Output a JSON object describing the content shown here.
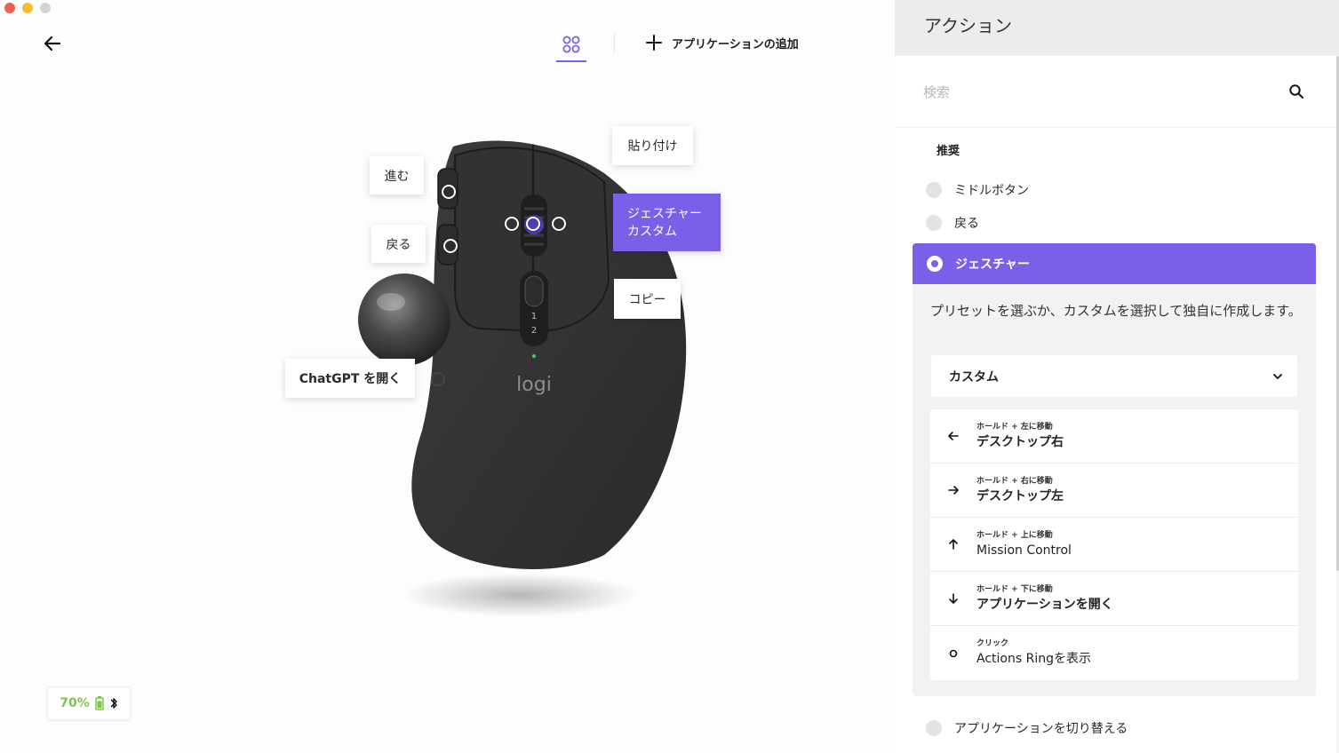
{
  "header": {
    "add_application_label": "アプリケーションの追加"
  },
  "mouse": {
    "brand_logo": "logi",
    "dpi_labels": [
      "1",
      "2"
    ],
    "callouts": {
      "paste": "貼り付け",
      "forward": "進む",
      "back": "戻る",
      "gesture_line1": "ジェスチャー",
      "gesture_line2": "カスタム",
      "copy": "コピー",
      "open_chatgpt": "ChatGPT を開く"
    }
  },
  "status": {
    "battery_percent": "70%",
    "battery_level": 0.7,
    "connection_icon": "bluetooth-icon"
  },
  "panel": {
    "title": "アクション",
    "search_placeholder": "検索",
    "section_recommended": "推奨",
    "options": {
      "middle_button": "ミドルボタン",
      "back": "戻る",
      "gesture": "ジェスチャー",
      "switch_app": "アプリケーションを切り替える"
    },
    "gesture_description": "プリセットを選ぶか、カスタムを選択して独自に作成します。",
    "preset_selected": "カスタム",
    "gestures": [
      {
        "icon": "arrow-left-icon",
        "hint": "ホールド + 左に移動",
        "action": "デスクトップ右",
        "bold": true
      },
      {
        "icon": "arrow-right-icon",
        "hint": "ホールド + 右に移動",
        "action": "デスクトップ左",
        "bold": true
      },
      {
        "icon": "arrow-up-icon",
        "hint": "ホールド + 上に移動",
        "action": "Mission Control",
        "bold": false
      },
      {
        "icon": "arrow-down-icon",
        "hint": "ホールド + 下に移動",
        "action": "アプリケーションを開く",
        "bold": true
      },
      {
        "icon": "circle-icon",
        "hint": "クリック",
        "action": "Actions Ringを表示",
        "bold": false
      }
    ]
  },
  "colors": {
    "accent": "#7b5fe8",
    "battery_green": "#7ac943"
  }
}
